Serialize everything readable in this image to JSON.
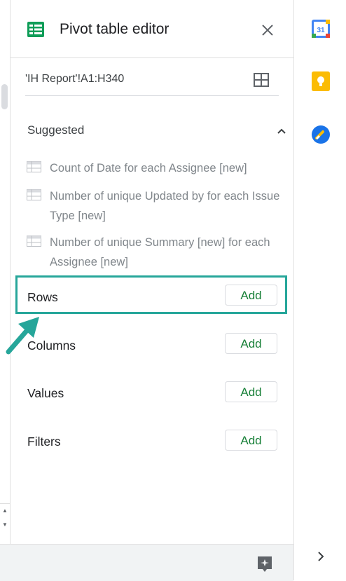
{
  "panel": {
    "title": "Pivot table editor",
    "range": "'IH Report'!A1:H340"
  },
  "suggested": {
    "label": "Suggested",
    "items": [
      {
        "text": "Count of Date for each Assignee [new]"
      },
      {
        "text": "Number of unique Updated by for each Issue\nType [new]"
      },
      {
        "text": "Number of unique Summary [new] for each\nAssignee [new]"
      }
    ]
  },
  "sections": {
    "rows": {
      "label": "Rows",
      "add": "Add"
    },
    "columns": {
      "label": "Columns",
      "add": "Add"
    },
    "values": {
      "label": "Values",
      "add": "Add"
    },
    "filters": {
      "label": "Filters",
      "add": "Add"
    }
  },
  "rail": {
    "calendar_day": "31"
  },
  "colors": {
    "sheets_green": "#0f9d58",
    "add_green": "#188038",
    "highlight": "#26a69a",
    "keep_yellow": "#fbbc04",
    "tasks_blue": "#1a73e8"
  },
  "icons": [
    "sheets-icon",
    "close-icon",
    "grid-select-icon",
    "chevron-up-icon",
    "table-icon",
    "arrow-icon",
    "explore-icon",
    "calendar-icon",
    "keep-icon",
    "tasks-icon",
    "chevron-right-icon"
  ]
}
